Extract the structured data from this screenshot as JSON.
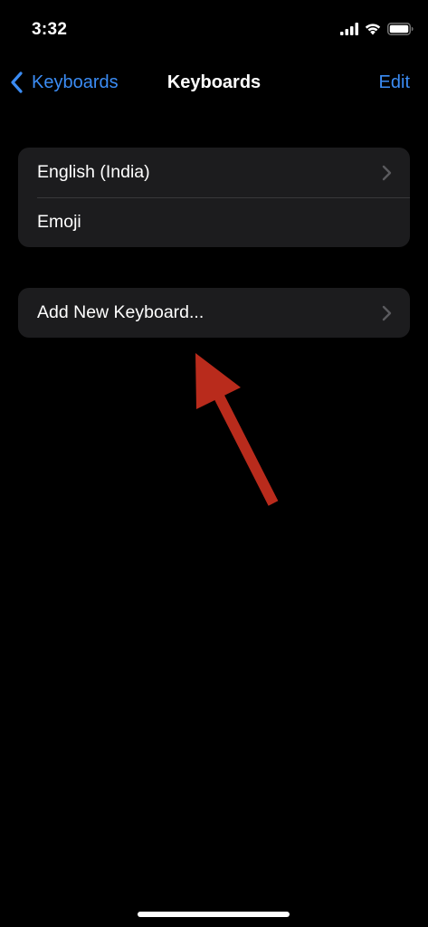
{
  "status_bar": {
    "time": "3:32",
    "icons": [
      "cellular-signal-icon",
      "wifi-icon",
      "battery-icon"
    ]
  },
  "nav": {
    "back_label": "Keyboards",
    "title": "Keyboards",
    "edit_label": "Edit"
  },
  "keyboards_group": {
    "items": [
      {
        "label": "English (India)",
        "has_chevron": true
      },
      {
        "label": "Emoji",
        "has_chevron": false
      }
    ]
  },
  "add_group": {
    "label": "Add New Keyboard..."
  },
  "colors": {
    "background": "#000000",
    "cell_background": "#1c1c1e",
    "accent": "#3b8cf4",
    "annotation_arrow": "#b92b1c"
  }
}
